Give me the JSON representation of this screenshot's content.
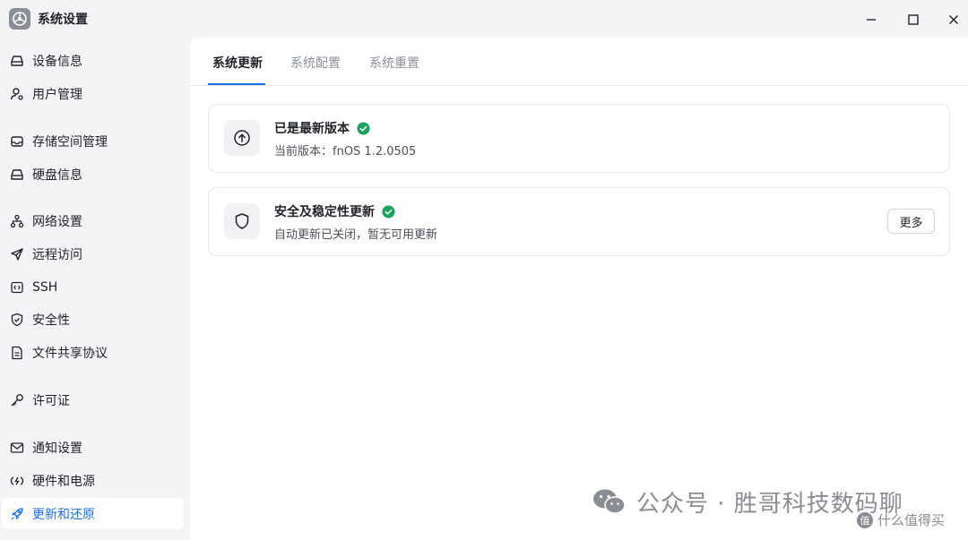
{
  "window": {
    "title": "系统设置",
    "icon": "gear-app-icon"
  },
  "sidebar": {
    "items": [
      {
        "label": "设备信息",
        "icon": "drive-icon"
      },
      {
        "label": "用户管理",
        "icon": "user-icon"
      },
      {
        "label": "存储空间管理",
        "icon": "storage-icon"
      },
      {
        "label": "硬盘信息",
        "icon": "drive-icon"
      },
      {
        "label": "网络设置",
        "icon": "network-icon"
      },
      {
        "label": "远程访问",
        "icon": "send-icon"
      },
      {
        "label": "SSH",
        "icon": "code-icon"
      },
      {
        "label": "安全性",
        "icon": "shield-check-icon"
      },
      {
        "label": "文件共享协议",
        "icon": "document-icon"
      },
      {
        "label": "许可证",
        "icon": "key-icon"
      },
      {
        "label": "通知设置",
        "icon": "mail-icon"
      },
      {
        "label": "硬件和电源",
        "icon": "power-icon"
      },
      {
        "label": "更新和还原",
        "icon": "rocket-icon",
        "active": true
      }
    ]
  },
  "tabs": [
    {
      "label": "系统更新",
      "active": true
    },
    {
      "label": "系统配置"
    },
    {
      "label": "系统重置"
    }
  ],
  "cards": [
    {
      "title": "已是最新版本",
      "subtitle": "当前版本：fnOS 1.2.0505",
      "icon": "upload-circle-icon",
      "status_icon": "check-circle-icon"
    },
    {
      "title": "安全及稳定性更新",
      "subtitle": "自动更新已关闭，暂无可用更新",
      "icon": "shield-icon",
      "status_icon": "check-circle-icon",
      "button": "更多"
    }
  ],
  "watermark": {
    "text": "公众号 · 胜哥科技数码聊",
    "sub": "什么值得买"
  },
  "colors": {
    "accent": "#1f6feb",
    "success": "#1aa260",
    "sidebar_bg": "#f3f4f6",
    "content_bg": "#ffffff"
  }
}
